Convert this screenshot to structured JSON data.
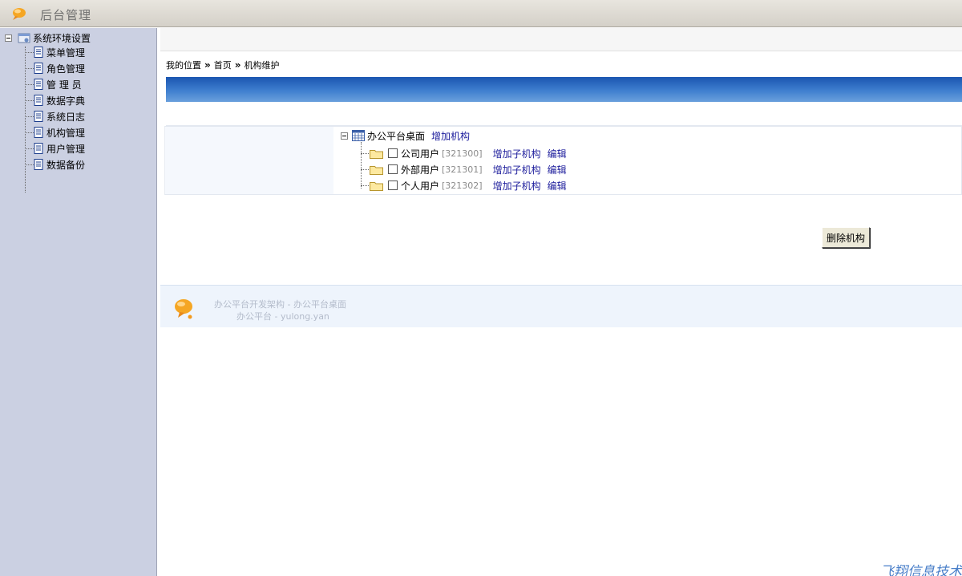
{
  "header": {
    "title": "后台管理"
  },
  "sidebar": {
    "root_label": "系统环境设置",
    "items": [
      {
        "label": "菜单管理"
      },
      {
        "label": "角色管理"
      },
      {
        "label": "管 理 员"
      },
      {
        "label": "数据字典"
      },
      {
        "label": "系统日志"
      },
      {
        "label": "机构管理"
      },
      {
        "label": "用户管理"
      },
      {
        "label": "数据备份"
      }
    ]
  },
  "breadcrumb": {
    "prefix": "我的位置",
    "sep": "»",
    "home": "首页",
    "current": "机构维护"
  },
  "org_tree": {
    "root_label": "办公平台桌面",
    "root_action": "增加机构",
    "children": [
      {
        "label": "公司用户",
        "code": "[321300]",
        "add": "增加子机构",
        "edit": "编辑"
      },
      {
        "label": "外部用户",
        "code": "[321301]",
        "add": "增加子机构",
        "edit": "编辑"
      },
      {
        "label": "个人用户",
        "code": "[321302]",
        "add": "增加子机构",
        "edit": "编辑"
      }
    ]
  },
  "actions": {
    "delete_label": "删除机构"
  },
  "footer": {
    "line1": "办公平台开发架构  -   办公平台桌面",
    "line2": "办公平台  -    yulong.yan"
  },
  "brand": "飞翔信息技术"
}
